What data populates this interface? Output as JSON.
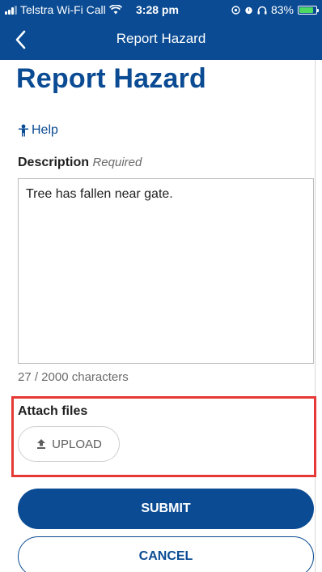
{
  "status_bar": {
    "carrier": "Telstra Wi-Fi Call",
    "time": "3:28 pm",
    "battery": "83%",
    "battery_level": 0.83
  },
  "nav": {
    "title": "Report Hazard",
    "back_icon": "chevron-left-icon"
  },
  "page": {
    "heading": "Report Hazard"
  },
  "help": {
    "label": "Help",
    "icon": "person-icon"
  },
  "description": {
    "label": "Description",
    "required_text": "Required",
    "value": "Tree has fallen near gate.",
    "counter": "27 / 2000 characters"
  },
  "attachments": {
    "label": "Attach files",
    "upload_label": "UPLOAD",
    "upload_icon": "upload-icon",
    "highlight_color": "#e53935"
  },
  "actions": {
    "submit_label": "SUBMIT",
    "cancel_label": "CANCEL"
  },
  "colors": {
    "brand": "#0a4b93"
  }
}
